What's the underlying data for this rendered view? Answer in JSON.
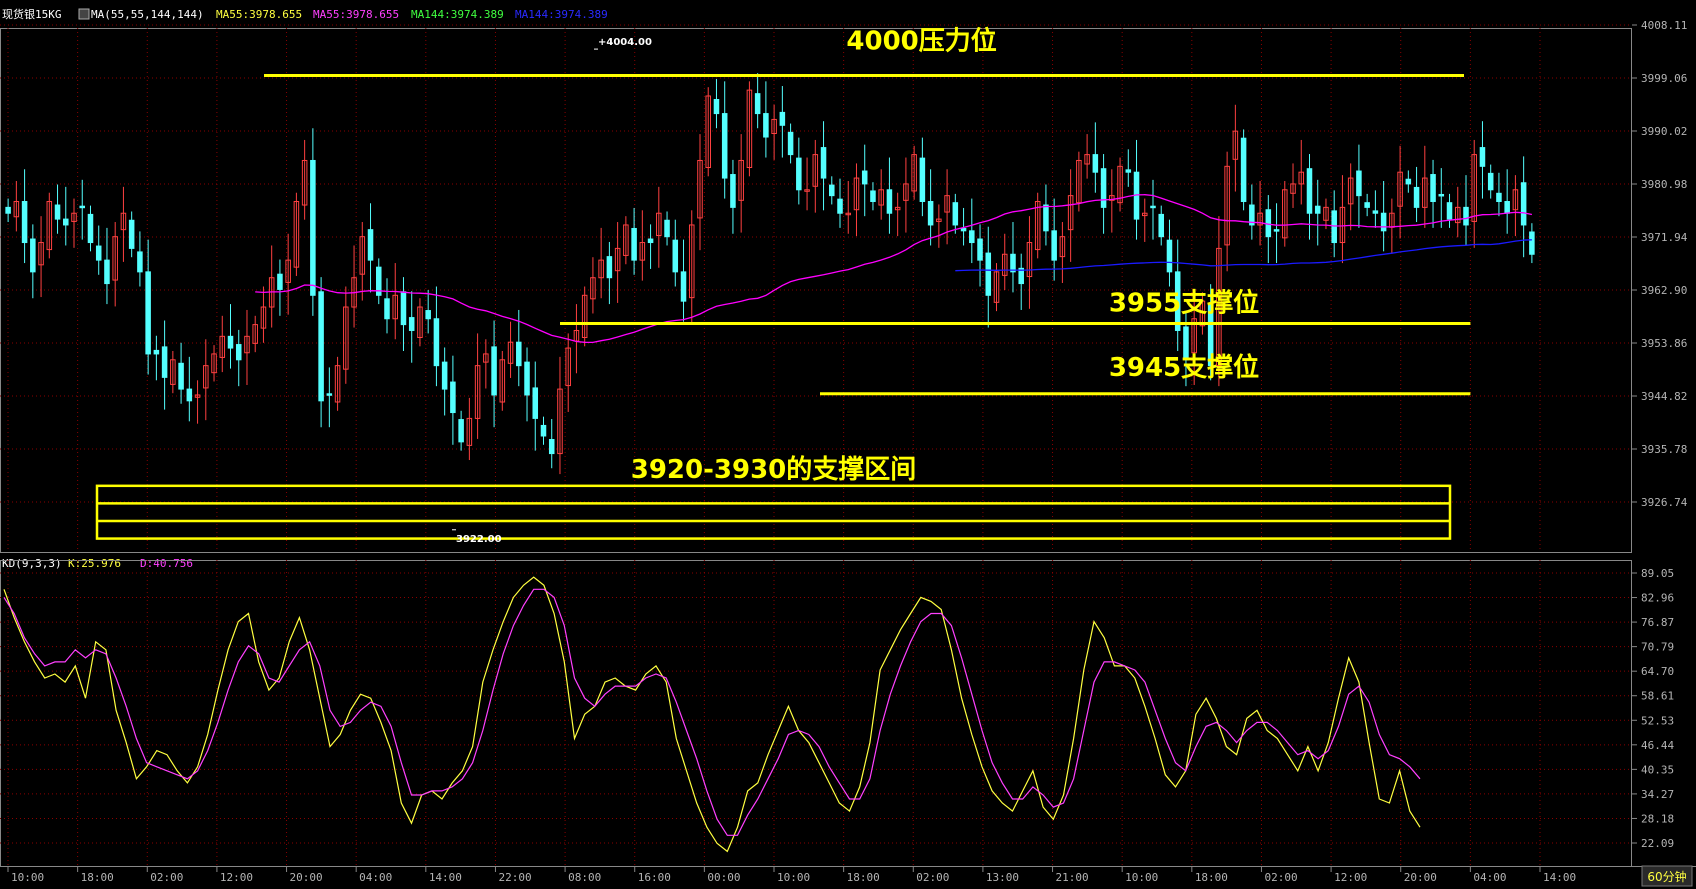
{
  "header": {
    "symbol": "现货银15KG",
    "ma_label": "MA(55,55,144,144)",
    "ma55_a": "MA55:3978.655",
    "ma55_b": "MA55:3978.655",
    "ma144_a": "MA144:3974.389",
    "ma144_b": "MA144:3974.389"
  },
  "kd_header": {
    "label": "KD(9,3,3)",
    "k": "K:25.976",
    "d": "D:40.756"
  },
  "timeframe_label": "60分钟",
  "colors": {
    "background": "#000000",
    "grid": "#8a0000",
    "up_candle": "#ff4040",
    "down_candle": "#54ffff",
    "ma55": "#ff00ff",
    "ma144": "#1a1aff",
    "annotation": "#ffff00",
    "k_line": "#ffff40",
    "d_line": "#ff40ff",
    "axis_text": "#b4b4b4"
  },
  "chart_data": [
    {
      "type": "candlestick",
      "title": "现货银15KG",
      "y_ticks": [
        "4008.11",
        "3999.06",
        "3990.02",
        "3980.98",
        "3971.94",
        "3962.90",
        "3953.86",
        "3944.82",
        "3935.78",
        "3926.74"
      ],
      "ylim": [
        3917,
        4012
      ],
      "x_ticks": [
        "10:00",
        "18:00",
        "02:00",
        "12:00",
        "20:00",
        "04:00",
        "14:00",
        "22:00",
        "08:00",
        "16:00",
        "00:00",
        "10:00",
        "18:00",
        "02:00",
        "13:00",
        "21:00",
        "10:00",
        "18:00",
        "02:00",
        "12:00",
        "20:00",
        "04:00",
        "14:00"
      ],
      "price_marks": [
        {
          "label": "4004.00",
          "value": 4004.0
        },
        {
          "label": "3922.00",
          "value": 3922.0
        }
      ],
      "levels": [
        {
          "label": "4000压力位",
          "value": 3999.5
        },
        {
          "label": "3955支撑位",
          "value": 3957.2
        },
        {
          "label": "3945支撑位",
          "value": 3945.2
        }
      ],
      "zone": {
        "label": "3920-3930的支撑区间",
        "from": 3920.5,
        "to": 3929.5
      },
      "candles_close": [
        3976,
        3978,
        3971,
        3966,
        3971,
        3978,
        3975,
        3974,
        3976,
        3977,
        3971,
        3968,
        3964,
        3972,
        3976,
        3970,
        3966,
        3952,
        3952,
        3948,
        3951,
        3946,
        3944,
        3945,
        3950,
        3952,
        3955,
        3953,
        3951,
        3955,
        3957,
        3960,
        3965,
        3963,
        3968,
        3978,
        3985,
        3962,
        3944,
        3945,
        3950,
        3960,
        3965,
        3972,
        3968,
        3962,
        3958,
        3962,
        3957,
        3956,
        3960,
        3958,
        3950,
        3946,
        3942,
        3937,
        3941,
        3950,
        3952,
        3945,
        3951,
        3954,
        3950,
        3945,
        3941,
        3938,
        3935,
        3946,
        3953,
        3956,
        3962,
        3965,
        3968,
        3965,
        3970,
        3974,
        3968,
        3971,
        3971,
        3976,
        3972,
        3966,
        3961,
        3974,
        3985,
        3996,
        3993,
        3982,
        3977,
        3985,
        3997,
        3993,
        3989,
        3992,
        3991,
        3986,
        3980,
        3980,
        3986,
        3982,
        3979,
        3976,
        3976,
        3982,
        3981,
        3978,
        3980,
        3976,
        3977,
        3981,
        3986,
        3978,
        3974,
        3975,
        3979,
        3974,
        3973,
        3971,
        3968,
        3962,
        3966,
        3969,
        3966,
        3964,
        3971,
        3978,
        3973,
        3968,
        3972,
        3979,
        3985,
        3986,
        3983,
        3977,
        3979,
        3984,
        3983,
        3975,
        3976,
        3977,
        3972,
        3966,
        3956,
        3951,
        3958,
        3961,
        3950,
        3970,
        3984,
        3990,
        3978,
        3974,
        3976,
        3972,
        3973,
        3980,
        3981,
        3983,
        3976,
        3976,
        3977,
        3971,
        3977,
        3982,
        3979,
        3977,
        3976,
        3973,
        3976,
        3983,
        3981,
        3977,
        3982,
        3978,
        3979,
        3975,
        3977,
        3974,
        3986,
        3984,
        3980,
        3978,
        3976,
        3980,
        3974,
        3969
      ]
    },
    {
      "type": "line",
      "title": "KD(9,3,3)",
      "y_ticks": [
        "89.05",
        "82.96",
        "76.87",
        "70.79",
        "64.70",
        "58.61",
        "52.53",
        "46.44",
        "40.35",
        "34.27",
        "28.18",
        "22.09"
      ],
      "ylim": [
        16,
        91
      ],
      "series": [
        {
          "name": "K",
          "values": [
            85,
            78,
            72,
            67,
            63,
            64,
            62,
            66,
            58,
            72,
            70,
            55,
            47,
            38,
            41,
            45,
            44,
            40,
            37,
            41,
            49,
            60,
            70,
            77,
            79,
            67,
            60,
            63,
            72,
            78,
            70,
            58,
            46,
            49,
            55,
            59,
            58,
            52,
            45,
            32,
            27,
            34,
            35,
            33,
            37,
            40,
            46,
            62,
            70,
            77,
            83,
            86,
            88,
            86,
            79,
            67,
            48,
            54,
            56,
            62,
            63,
            61,
            60,
            64,
            66,
            62,
            48,
            40,
            32,
            26,
            22,
            20,
            26,
            35,
            37,
            44,
            50,
            56,
            50,
            47,
            42,
            37,
            32,
            30,
            36,
            47,
            65,
            70,
            75,
            79,
            83,
            82,
            80,
            70,
            58,
            49,
            41,
            35,
            32,
            30,
            35,
            40,
            31,
            28,
            34,
            48,
            65,
            77,
            73,
            66,
            66,
            63,
            56,
            48,
            39,
            36,
            40,
            54,
            58,
            53,
            46,
            44,
            53,
            55,
            50,
            48,
            44,
            40,
            46,
            40,
            47,
            58,
            68,
            62,
            47,
            33,
            32,
            40,
            30,
            26
          ]
        },
        {
          "name": "D",
          "values": [
            83,
            79,
            73,
            69,
            66,
            67,
            67,
            70,
            68,
            70,
            69,
            63,
            56,
            48,
            42,
            41,
            40,
            39,
            38,
            40,
            45,
            52,
            60,
            67,
            71,
            69,
            63,
            62,
            66,
            70,
            72,
            66,
            55,
            51,
            52,
            55,
            57,
            56,
            51,
            42,
            34,
            34,
            35,
            35,
            36,
            38,
            42,
            50,
            60,
            69,
            76,
            81,
            85,
            85,
            83,
            76,
            63,
            58,
            56,
            59,
            61,
            61,
            61,
            63,
            64,
            63,
            57,
            50,
            43,
            35,
            28,
            24,
            24,
            29,
            33,
            38,
            43,
            49,
            50,
            49,
            46,
            41,
            37,
            33,
            33,
            38,
            50,
            59,
            66,
            72,
            77,
            79,
            79,
            76,
            68,
            59,
            50,
            42,
            37,
            33,
            33,
            36,
            34,
            31,
            32,
            38,
            50,
            62,
            67,
            67,
            66,
            65,
            62,
            55,
            48,
            42,
            40,
            46,
            51,
            52,
            50,
            47,
            50,
            52,
            52,
            50,
            47,
            44,
            45,
            43,
            45,
            51,
            59,
            61,
            57,
            49,
            44,
            43,
            41,
            38
          ]
        }
      ]
    }
  ]
}
